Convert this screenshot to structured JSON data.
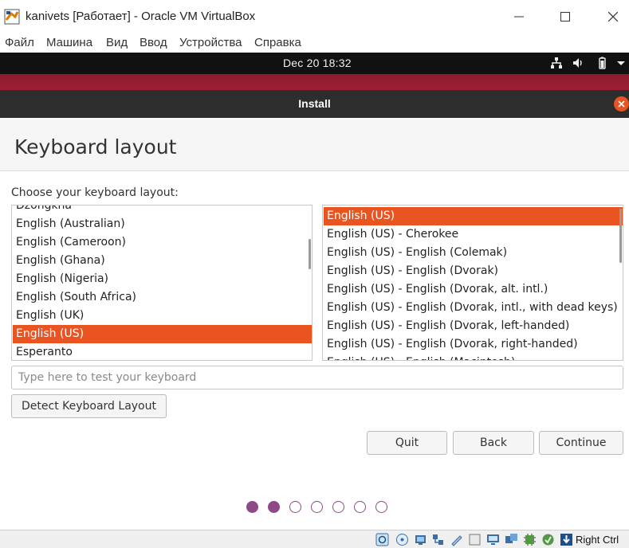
{
  "host_window": {
    "title": "kanivets [Работает] - Oracle VM VirtualBox",
    "icon": "virtualbox-app-icon",
    "controls": [
      "minimize-icon",
      "maximize-icon",
      "close-icon"
    ]
  },
  "host_menu": {
    "items": [
      "Файл",
      "Машина",
      "Вид",
      "Ввод",
      "Устройства",
      "Справка"
    ]
  },
  "guest_topbar": {
    "clock": "Dec 20  18:32",
    "tray_icons": [
      "network-icon",
      "volume-icon",
      "battery-icon",
      "chevron-down-icon"
    ]
  },
  "installer": {
    "window_title": "Install",
    "page_title": "Keyboard layout",
    "choose_label": "Choose your keyboard layout:",
    "layouts": [
      {
        "label": "Dzongkha",
        "selected": false
      },
      {
        "label": "English (Australian)",
        "selected": false
      },
      {
        "label": "English (Cameroon)",
        "selected": false
      },
      {
        "label": "English (Ghana)",
        "selected": false
      },
      {
        "label": "English (Nigeria)",
        "selected": false
      },
      {
        "label": "English (South Africa)",
        "selected": false
      },
      {
        "label": "English (UK)",
        "selected": false
      },
      {
        "label": "English (US)",
        "selected": true
      },
      {
        "label": "Esperanto",
        "selected": false
      }
    ],
    "variants": [
      {
        "label": "English (US)",
        "selected": true
      },
      {
        "label": "English (US) - Cherokee",
        "selected": false
      },
      {
        "label": "English (US) - English (Colemak)",
        "selected": false
      },
      {
        "label": "English (US) - English (Dvorak)",
        "selected": false
      },
      {
        "label": "English (US) - English (Dvorak, alt. intl.)",
        "selected": false
      },
      {
        "label": "English (US) - English (Dvorak, intl., with dead keys)",
        "selected": false
      },
      {
        "label": "English (US) - English (Dvorak, left-handed)",
        "selected": false
      },
      {
        "label": "English (US) - English (Dvorak, right-handed)",
        "selected": false
      },
      {
        "label": "English (US) - English (Macintosh)",
        "selected": false
      }
    ],
    "test_input": {
      "placeholder": "Type here to test your keyboard",
      "value": ""
    },
    "detect_button": "Detect Keyboard Layout",
    "quit_button": "Quit",
    "back_button": "Back",
    "continue_button": "Continue",
    "progress": {
      "total_steps": 7,
      "completed_steps": 2
    },
    "accent_color": "#e95420"
  },
  "host_statusbar": {
    "icons": [
      "optical-drive-icon",
      "audio-icon",
      "network-adapter-icon",
      "usb-icon",
      "shared-folder-icon",
      "display-icon",
      "screen-icon",
      "recording-icon",
      "cpu-icon",
      "mouse-integration-icon",
      "host-key-arrow-icon"
    ],
    "host_key_label": "Right Ctrl"
  }
}
